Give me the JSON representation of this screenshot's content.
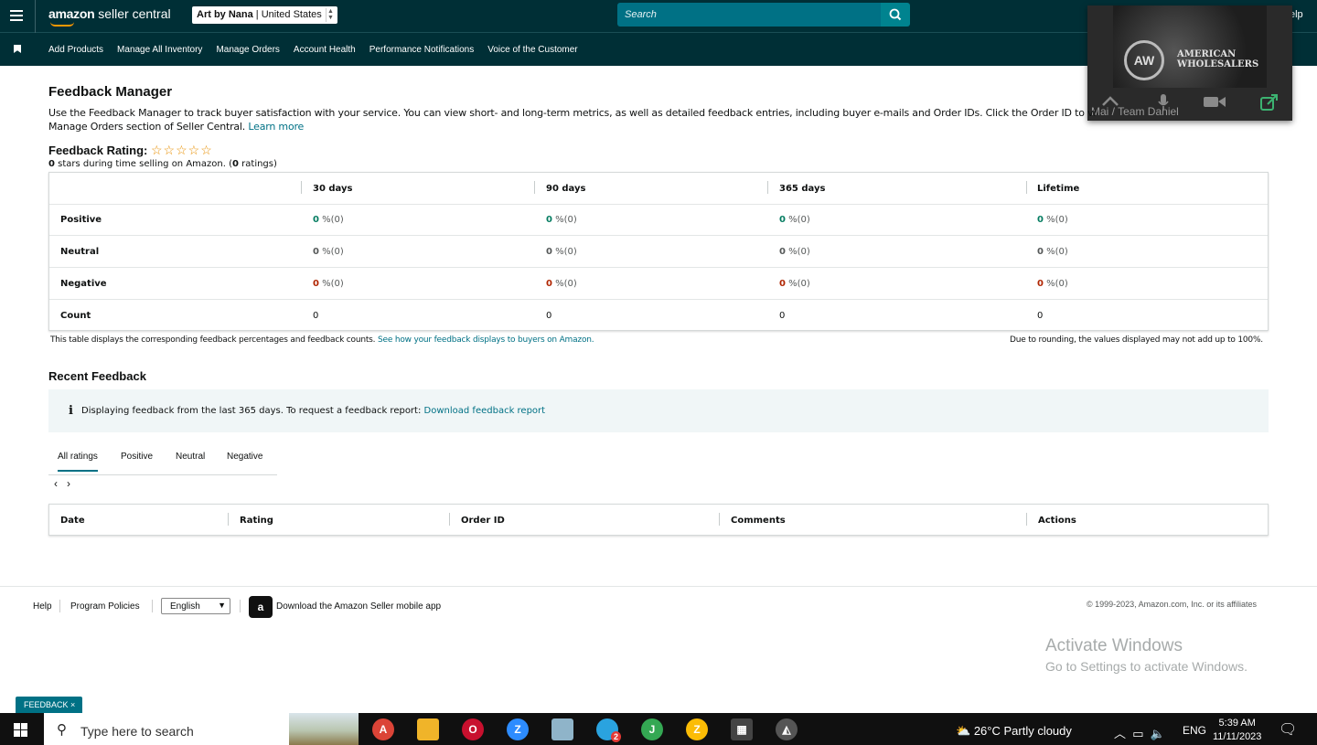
{
  "header": {
    "brand": "amazon seller central",
    "brand_bold": "amazon",
    "brand_rest": "seller central",
    "store_name": "Art by Nana",
    "store_region": "United States",
    "search_placeholder": "Search",
    "help_partial": "elp"
  },
  "nav": {
    "items": [
      "Add Products",
      "Manage All Inventory",
      "Manage Orders",
      "Account Health",
      "Performance Notifications",
      "Voice of the Customer"
    ]
  },
  "video_overlay": {
    "brand_line1": "AMERICAN",
    "brand_line2": "WHOLESALERS",
    "caption": "Mai / Team Daniel"
  },
  "page": {
    "title": "Feedback Manager",
    "description_1": "Use the Feedback Manager to track buyer satisfaction with your service. You can view short- and long-term metrics, as well as detailed feedback entries, including buyer e-mails and Order IDs. Click the Order ID to vi",
    "description_2": "Manage Orders section of Seller Central.",
    "learn_more": "Learn more",
    "rating_label": "Feedback Rating:",
    "rating_stars": 0,
    "stars_value": "0",
    "stars_text": "stars during time selling on Amazon. (",
    "ratings_count": "0",
    "ratings_text": "ratings)"
  },
  "feedback_table": {
    "columns": [
      "30 days",
      "90 days",
      "365 days",
      "Lifetime"
    ],
    "rows": [
      {
        "label": "Positive",
        "values": [
          "0",
          "0",
          "0",
          "0"
        ],
        "counts": [
          "%(0)",
          "%(0)",
          "%(0)",
          "%(0)"
        ]
      },
      {
        "label": "Neutral",
        "values": [
          "0",
          "0",
          "0",
          "0"
        ],
        "counts": [
          "%(0)",
          "%(0)",
          "%(0)",
          "%(0)"
        ]
      },
      {
        "label": "Negative",
        "values": [
          "0",
          "0",
          "0",
          "0"
        ],
        "counts": [
          "%(0)",
          "%(0)",
          "%(0)",
          "%(0)"
        ]
      },
      {
        "label": "Count",
        "values": [
          "0",
          "0",
          "0",
          "0"
        ]
      }
    ],
    "note_left": "This table displays the corresponding feedback percentages and feedback counts.",
    "note_link": "See how your feedback displays to buyers on Amazon.",
    "note_right": "Due to rounding, the values displayed may not add up to 100%.",
    "colors": {
      "positive": "#067d62",
      "negative": "#b12704",
      "neutral": "#565959"
    }
  },
  "recent": {
    "title": "Recent Feedback",
    "info_text": "Displaying feedback from the last 365 days. To request a feedback report:",
    "info_link": "Download feedback report",
    "tabs": [
      "All ratings",
      "Positive",
      "Neutral",
      "Negative"
    ],
    "active_tab": "All ratings",
    "columns": [
      "Date",
      "Rating",
      "Order ID",
      "Comments",
      "Actions"
    ]
  },
  "footer": {
    "help": "Help",
    "policies": "Program Policies",
    "language": "English",
    "app_text": "Download the Amazon Seller mobile app",
    "copyright": "© 1999-2023, Amazon.com, Inc. or its affiliates"
  },
  "watermark": {
    "line1": "Activate Windows",
    "line2": "Go to Settings to activate Windows."
  },
  "feedback_button": "FEEDBACK",
  "taskbar": {
    "search_text": "Type here to search",
    "weather": "26°C  Partly cloudy",
    "lang": "ENG",
    "time": "5:39 AM",
    "date": "11/11/2023",
    "telegram_badge": "2"
  }
}
